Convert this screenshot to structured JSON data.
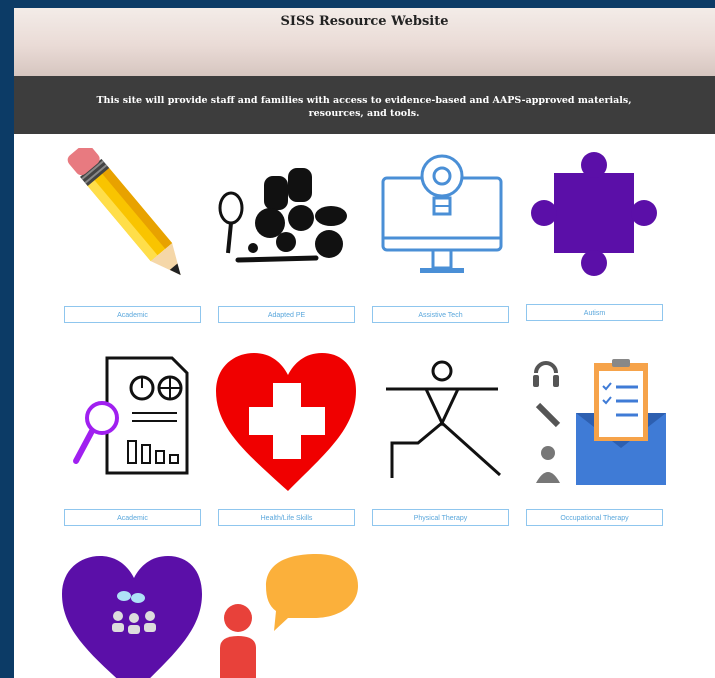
{
  "header": {
    "title": "SISS Resource Website",
    "tagline": "This site will provide staff and families with access to evidence-based and AAPS-approved materials, resources, and tools."
  },
  "tiles": [
    {
      "label": "Academic",
      "icon": "pencil-icon"
    },
    {
      "label": "Adapted PE",
      "icon": "sports-equipment-icon"
    },
    {
      "label": "Assistive Tech",
      "icon": "computer-lightbulb-icon"
    },
    {
      "label": "Autism",
      "icon": "puzzle-piece-icon"
    },
    {
      "label": "Academic",
      "icon": "report-magnifier-icon"
    },
    {
      "label": "Health/Life Skills",
      "icon": "health-heart-icon"
    },
    {
      "label": "Physical Therapy",
      "icon": "stretching-figure-icon"
    },
    {
      "label": "Occupational Therapy",
      "icon": "clipboard-envelope-icon"
    },
    {
      "label": "",
      "icon": "social-group-heart-icon"
    },
    {
      "label": "",
      "icon": "speech-bubble-person-icon"
    }
  ],
  "colors": {
    "outer_border": "#0c3b66",
    "tagline_band": "#3d3d3d",
    "button_border": "#8fc6ee",
    "purple": "#5b0fa8",
    "red": "#f00000",
    "blue": "#4a8fd6",
    "orange": "#fbb03b"
  }
}
